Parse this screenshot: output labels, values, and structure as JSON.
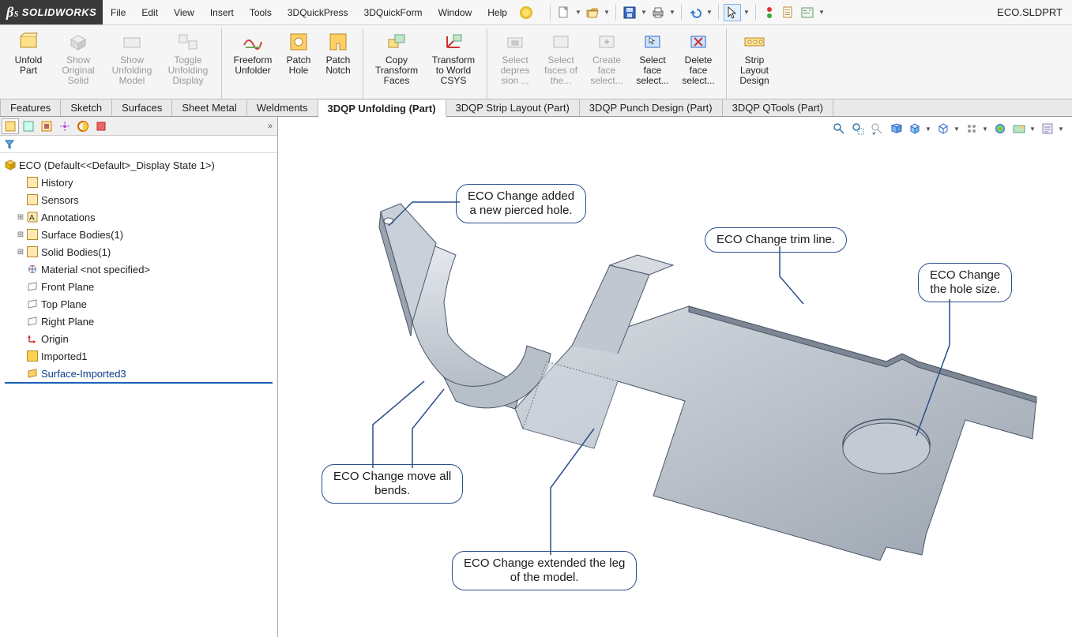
{
  "app": {
    "logo_text": "SOLIDWORKS",
    "doc_name": "ECO.SLDPRT"
  },
  "menu": [
    "File",
    "Edit",
    "View",
    "Insert",
    "Tools",
    "3DQuickPress",
    "3DQuickForm",
    "Window",
    "Help"
  ],
  "ribbon": {
    "groups": [
      {
        "buttons": [
          {
            "label": "Unfold Part",
            "disabled": false,
            "icon": "unfold-icon"
          },
          {
            "label": "Show Original Solid",
            "disabled": true,
            "icon": "show-orig-icon"
          },
          {
            "label": "Show Unfolding Model",
            "disabled": true,
            "icon": "show-unfold-icon"
          },
          {
            "label": "Toggle Unfolding Display",
            "disabled": true,
            "icon": "toggle-disp-icon"
          }
        ]
      },
      {
        "buttons": [
          {
            "label": "Freeform Unfolder",
            "disabled": false,
            "icon": "freeform-icon"
          },
          {
            "label": "Patch Hole",
            "disabled": false,
            "icon": "patch-hole-icon"
          },
          {
            "label": "Patch Notch",
            "disabled": false,
            "icon": "patch-notch-icon"
          }
        ]
      },
      {
        "buttons": [
          {
            "label": "Copy Transform Faces",
            "disabled": false,
            "icon": "copy-xform-icon"
          },
          {
            "label": "Transform to World CSYS",
            "disabled": false,
            "icon": "xform-world-icon"
          }
        ]
      },
      {
        "buttons": [
          {
            "label": "Select depres sion ...",
            "disabled": true,
            "icon": "sel-depr-icon"
          },
          {
            "label": "Select faces of the...",
            "disabled": true,
            "icon": "sel-faces-icon"
          },
          {
            "label": "Create face select...",
            "disabled": true,
            "icon": "create-sel-icon"
          },
          {
            "label": "Select face select...",
            "disabled": false,
            "icon": "sel-face-icon"
          },
          {
            "label": "Delete face select...",
            "disabled": false,
            "icon": "del-face-icon"
          }
        ]
      },
      {
        "buttons": [
          {
            "label": "Strip Layout Design",
            "disabled": false,
            "icon": "strip-layout-icon"
          }
        ]
      }
    ]
  },
  "feature_tabs": [
    {
      "label": "Features",
      "active": false
    },
    {
      "label": "Sketch",
      "active": false
    },
    {
      "label": "Surfaces",
      "active": false
    },
    {
      "label": "Sheet Metal",
      "active": false
    },
    {
      "label": "Weldments",
      "active": false
    },
    {
      "label": "3DQP Unfolding (Part)",
      "active": true
    },
    {
      "label": "3DQP Strip Layout (Part)",
      "active": false
    },
    {
      "label": "3DQP Punch Design (Part)",
      "active": false
    },
    {
      "label": "3DQP QTools (Part)",
      "active": false
    }
  ],
  "tree": {
    "root": "ECO  (Default<<Default>_Display State 1>)",
    "items": [
      {
        "label": "History",
        "icon": "history-icon",
        "exp": ""
      },
      {
        "label": "Sensors",
        "icon": "sensors-icon",
        "exp": ""
      },
      {
        "label": "Annotations",
        "icon": "annotations-icon",
        "exp": "+"
      },
      {
        "label": "Surface Bodies(1)",
        "icon": "surfbody-icon",
        "exp": "+"
      },
      {
        "label": "Solid Bodies(1)",
        "icon": "solidbody-icon",
        "exp": "+"
      },
      {
        "label": "Material <not specified>",
        "icon": "material-icon",
        "exp": ""
      },
      {
        "label": "Front Plane",
        "icon": "plane-icon",
        "exp": ""
      },
      {
        "label": "Top Plane",
        "icon": "plane-icon",
        "exp": ""
      },
      {
        "label": "Right Plane",
        "icon": "plane-icon",
        "exp": ""
      },
      {
        "label": "Origin",
        "icon": "origin-icon",
        "exp": ""
      },
      {
        "label": "Imported1",
        "icon": "imported-icon",
        "exp": ""
      },
      {
        "label": "Surface-Imported3",
        "icon": "surfimp-icon",
        "exp": ""
      }
    ]
  },
  "callouts": {
    "c1": {
      "line1": "ECO Change added",
      "line2": "a new pierced hole."
    },
    "c2": {
      "line1": "ECO Change trim line."
    },
    "c3": {
      "line1": "ECO Change",
      "line2": "the hole size."
    },
    "c4": {
      "line1": "ECO Change move all",
      "line2": "bends."
    },
    "c5": {
      "line1": "ECO Change extended the leg",
      "line2": "of the model."
    }
  }
}
